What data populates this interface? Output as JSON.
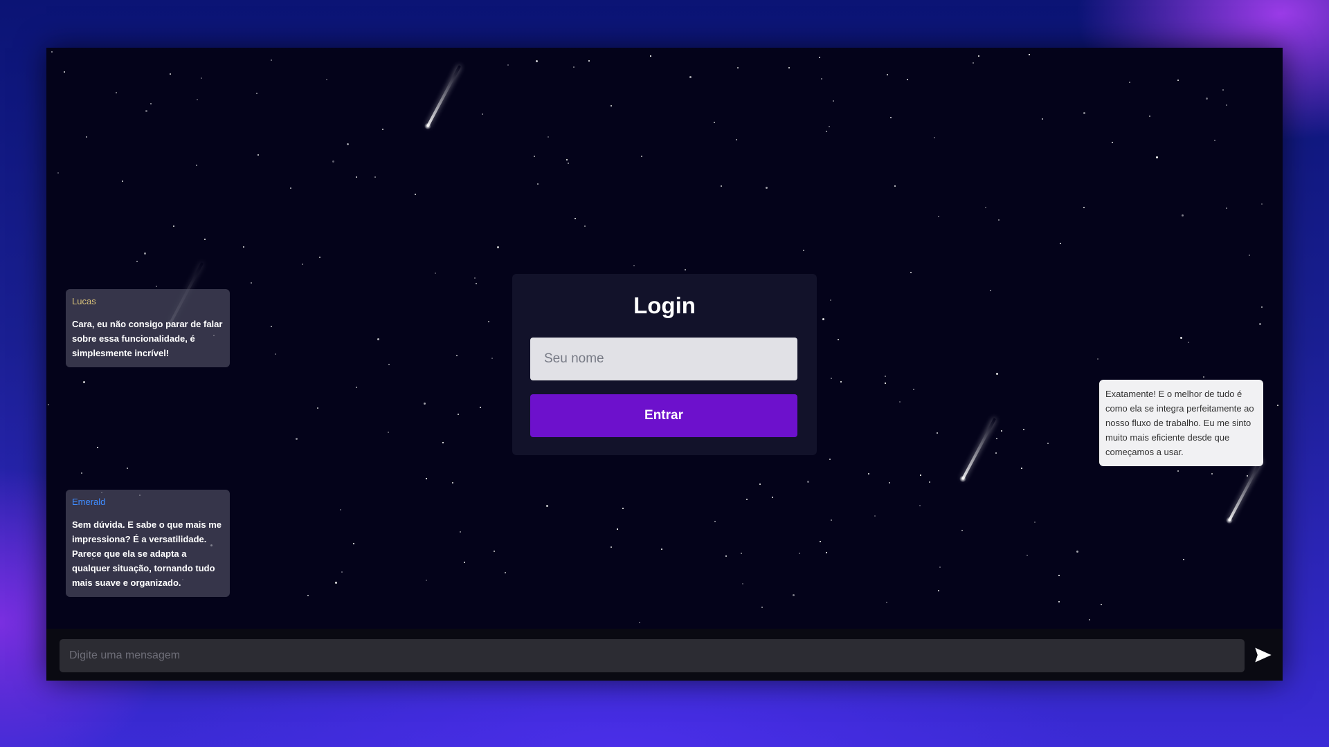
{
  "login": {
    "title": "Login",
    "name_placeholder": "Seu nome",
    "submit_label": "Entrar"
  },
  "chat": {
    "messages": [
      {
        "author": "Lucas",
        "author_color": "#d9c27a",
        "text": "Cara, eu não consigo parar de falar sobre essa funcionalidade, é simplesmente incrível!"
      },
      {
        "author": "Emerald",
        "author_color": "#3f8cff",
        "text": "Sem dúvida. E sabe o que mais me impressiona? É a versatilidade. Parece que ela se adapta a qualquer situação, tornando tudo mais suave e organizado."
      },
      {
        "text": "Exatamente! E o melhor de tudo é como ela se integra perfeitamente ao nosso fluxo de trabalho. Eu me sinto muito mais eficiente desde que começamos a usar."
      }
    ]
  },
  "composer": {
    "placeholder": "Digite uma mensagem",
    "send_icon": "send-icon"
  },
  "colors": {
    "accent": "#6d11cc",
    "background": "#04031a",
    "card": "#12122a"
  }
}
